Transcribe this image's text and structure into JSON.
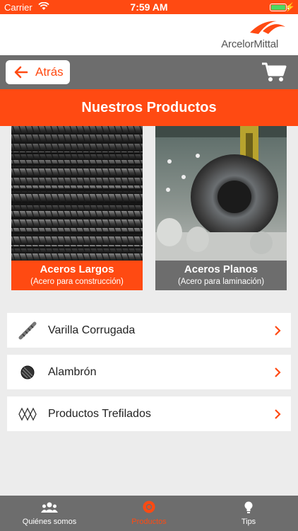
{
  "status_bar": {
    "carrier": "Carrier",
    "time": "7:59 AM"
  },
  "brand": {
    "logo_text": "ArcelorMittal"
  },
  "navbar": {
    "back_label": "Atrás"
  },
  "title": "Nuestros Productos",
  "cards": [
    {
      "name": "Aceros Largos",
      "subtitle": "(Acero para construcción)"
    },
    {
      "name": "Aceros Planos",
      "subtitle": "(Acero para laminación)"
    }
  ],
  "list": [
    {
      "label": "Varilla Corrugada",
      "icon": "rebar-icon"
    },
    {
      "label": "Alambrón",
      "icon": "wire-coil-icon"
    },
    {
      "label": "Productos Trefilados",
      "icon": "wire-mesh-icon"
    }
  ],
  "tabs": [
    {
      "label": "Quiénes somos",
      "icon": "people-icon",
      "active": false
    },
    {
      "label": "Productos",
      "icon": "products-icon",
      "active": true
    },
    {
      "label": "Tips",
      "icon": "lightbulb-icon",
      "active": false
    }
  ],
  "colors": {
    "accent": "#ff4a12",
    "bar_gray": "#6d6d6d",
    "background": "#ececec"
  }
}
